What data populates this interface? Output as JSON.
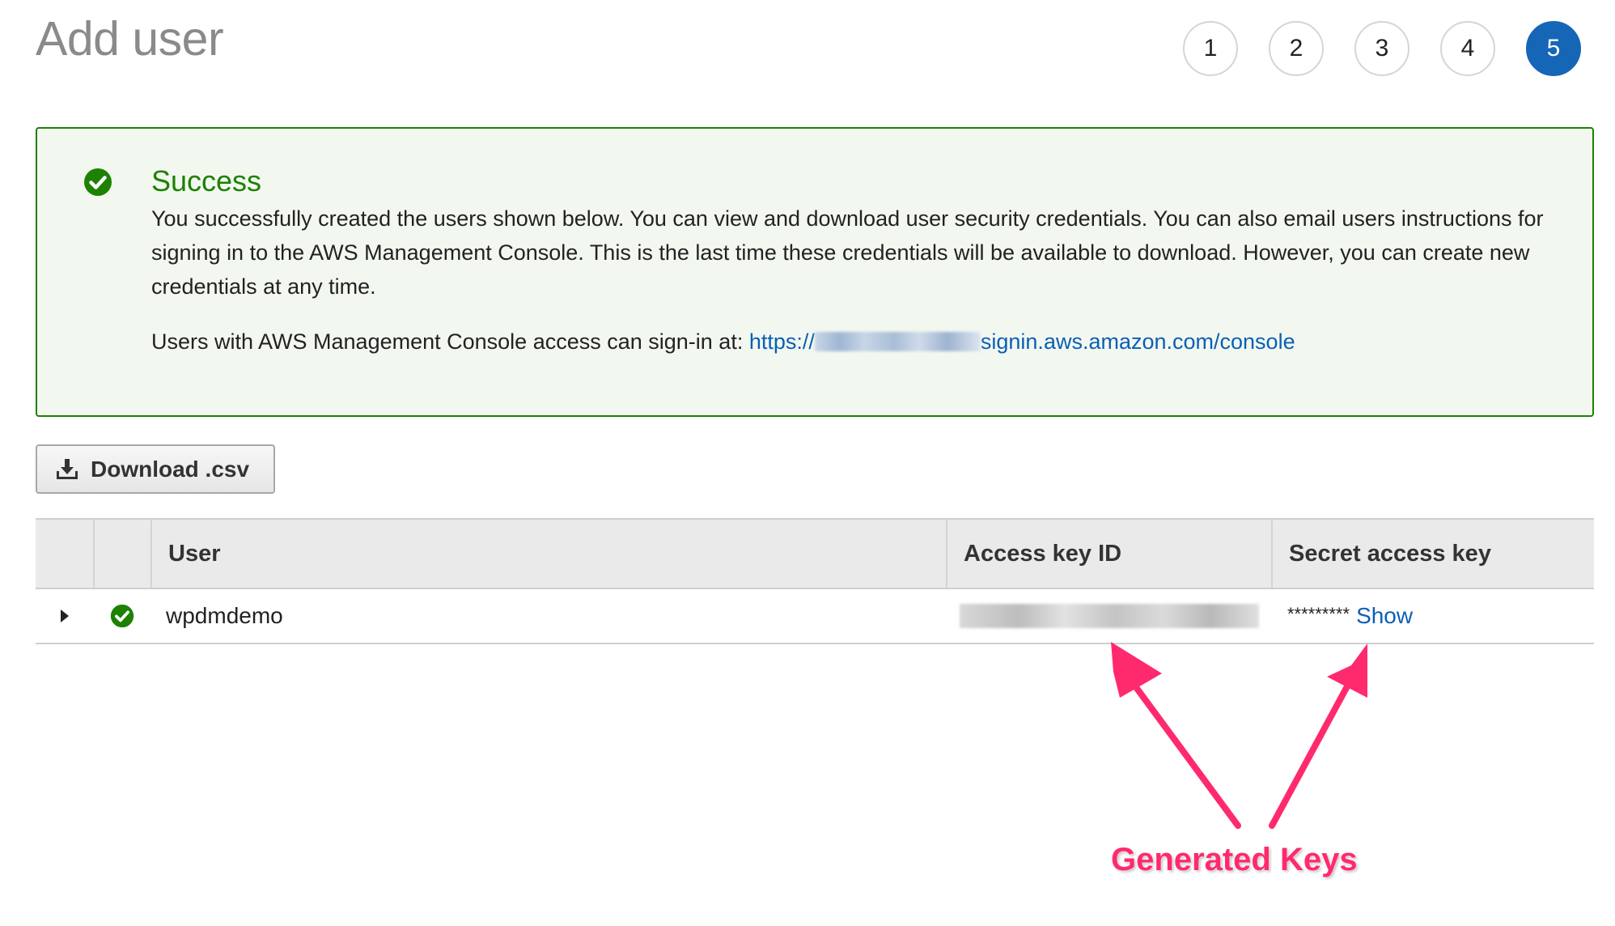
{
  "page": {
    "title": "Add user"
  },
  "steps": [
    {
      "label": "1",
      "active": false
    },
    {
      "label": "2",
      "active": false
    },
    {
      "label": "3",
      "active": false
    },
    {
      "label": "4",
      "active": false
    },
    {
      "label": "5",
      "active": true
    }
  ],
  "alert": {
    "title": "Success",
    "body": "You successfully created the users shown below. You can view and download user security credentials. You can also email users instructions for signing in to the AWS Management Console. This is the last time these credentials will be available to download. However, you can create new credentials at any time.",
    "signin_prefix": "Users with AWS Management Console access can sign-in at:",
    "signin_link_start": "https://",
    "signin_link_end": "signin.aws.amazon.com/console",
    "success_color": "#1d8102"
  },
  "download_button": {
    "label": "Download .csv"
  },
  "table": {
    "columns": [
      "",
      "",
      "User",
      "Access key ID",
      "Secret access key"
    ],
    "rows": [
      {
        "user": "wpdmdemo",
        "secret_mask": "*********",
        "show_label": "Show"
      }
    ]
  },
  "annotation": {
    "label": "Generated Keys",
    "color": "#ff2a6d"
  },
  "colors": {
    "accent": "#1566b7",
    "link": "#0b5fb5"
  }
}
